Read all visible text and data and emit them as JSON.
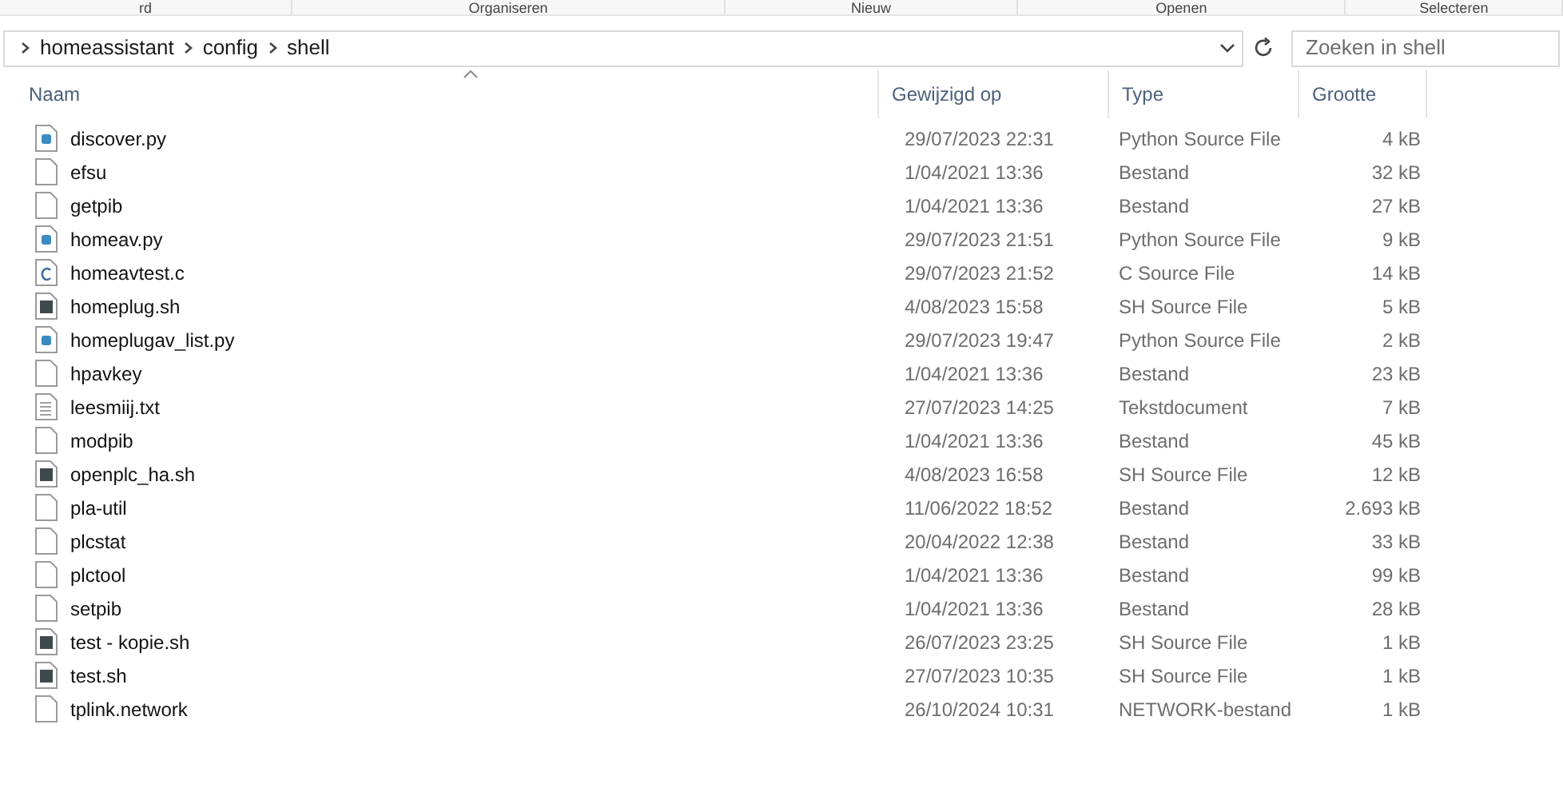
{
  "ribbon_groups": [
    "rd",
    "Organiseren",
    "Nieuw",
    "Openen",
    "Selecteren"
  ],
  "breadcrumb": [
    "homeassistant",
    "config",
    "shell"
  ],
  "search": {
    "placeholder": "Zoeken in shell"
  },
  "columns": [
    {
      "label": "Naam",
      "sorted": true
    },
    {
      "label": "Gewijzigd op",
      "sorted": false
    },
    {
      "label": "Type",
      "sorted": false
    },
    {
      "label": "Grootte",
      "sorted": false
    }
  ],
  "rows": [
    {
      "kind": "python",
      "name": "discover.py",
      "modified": "29/07/2023 22:31",
      "type": "Python Source File",
      "size": "4 kB"
    },
    {
      "kind": "blank",
      "name": "efsu",
      "modified": "1/04/2021 13:36",
      "type": "Bestand",
      "size": "32 kB"
    },
    {
      "kind": "blank",
      "name": "getpib",
      "modified": "1/04/2021 13:36",
      "type": "Bestand",
      "size": "27 kB"
    },
    {
      "kind": "python",
      "name": "homeav.py",
      "modified": "29/07/2023 21:51",
      "type": "Python Source File",
      "size": "9 kB"
    },
    {
      "kind": "c",
      "name": "homeavtest.c",
      "modified": "29/07/2023 21:52",
      "type": "C Source File",
      "size": "14 kB"
    },
    {
      "kind": "script",
      "name": "homeplug.sh",
      "modified": "4/08/2023 15:58",
      "type": "SH Source File",
      "size": "5 kB"
    },
    {
      "kind": "python",
      "name": "homeplugav_list.py",
      "modified": "29/07/2023 19:47",
      "type": "Python Source File",
      "size": "2 kB"
    },
    {
      "kind": "blank",
      "name": "hpavkey",
      "modified": "1/04/2021 13:36",
      "type": "Bestand",
      "size": "23 kB"
    },
    {
      "kind": "text",
      "name": "leesmiij.txt",
      "modified": "27/07/2023 14:25",
      "type": "Tekstdocument",
      "size": "7 kB"
    },
    {
      "kind": "blank",
      "name": "modpib",
      "modified": "1/04/2021 13:36",
      "type": "Bestand",
      "size": "45 kB"
    },
    {
      "kind": "script",
      "name": "openplc_ha.sh",
      "modified": "4/08/2023 16:58",
      "type": "SH Source File",
      "size": "12 kB"
    },
    {
      "kind": "blank",
      "name": "pla-util",
      "modified": "11/06/2022 18:52",
      "type": "Bestand",
      "size": "2.693 kB"
    },
    {
      "kind": "blank",
      "name": "plcstat",
      "modified": "20/04/2022 12:38",
      "type": "Bestand",
      "size": "33 kB"
    },
    {
      "kind": "blank",
      "name": "plctool",
      "modified": "1/04/2021 13:36",
      "type": "Bestand",
      "size": "99 kB"
    },
    {
      "kind": "blank",
      "name": "setpib",
      "modified": "1/04/2021 13:36",
      "type": "Bestand",
      "size": "28 kB"
    },
    {
      "kind": "script",
      "name": "test - kopie.sh",
      "modified": "26/07/2023 23:25",
      "type": "SH Source File",
      "size": "1 kB"
    },
    {
      "kind": "script",
      "name": "test.sh",
      "modified": "27/07/2023 10:35",
      "type": "SH Source File",
      "size": "1 kB"
    },
    {
      "kind": "blank",
      "name": "tplink.network",
      "modified": "26/10/2024 10:31",
      "type": "NETWORK-bestand",
      "size": "1 kB"
    }
  ]
}
